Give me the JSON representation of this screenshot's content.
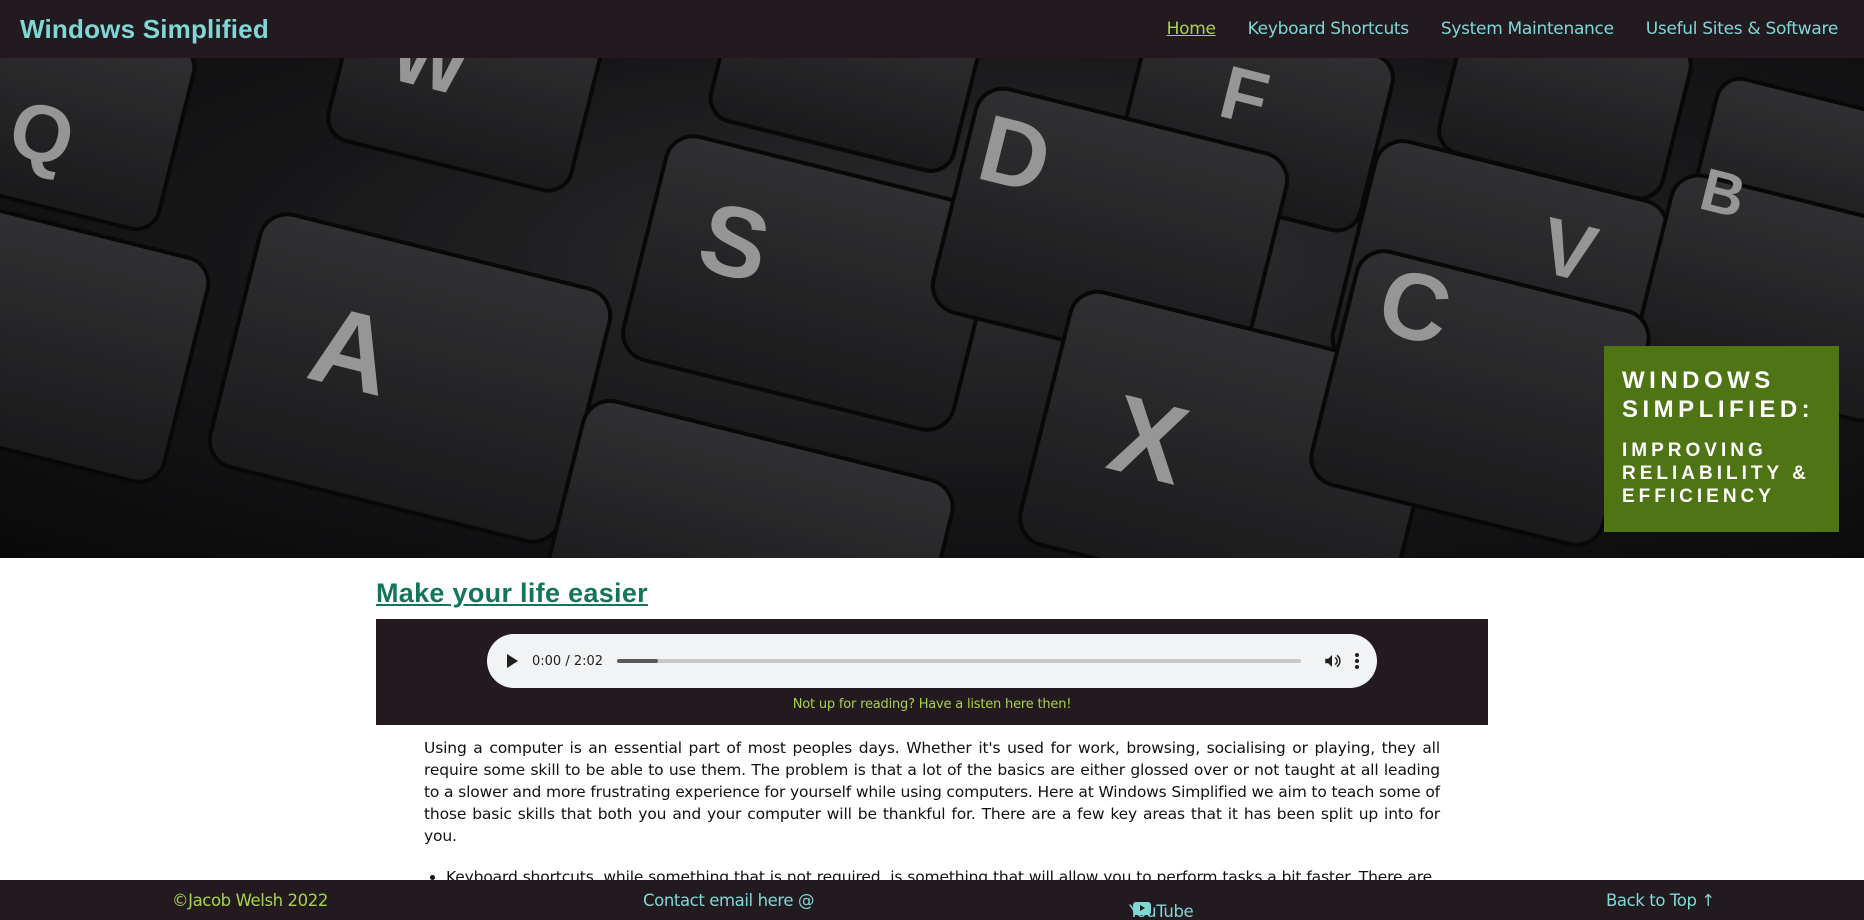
{
  "header": {
    "brand": "Windows Simplified",
    "nav": [
      {
        "label": "Home",
        "active": true
      },
      {
        "label": "Keyboard Shortcuts",
        "active": false
      },
      {
        "label": "System Maintenance",
        "active": false
      },
      {
        "label": "Useful Sites & Software",
        "active": false
      }
    ]
  },
  "hero": {
    "image": "keyboard-keys-photo",
    "badge_title": "WINDOWS SIMPLIFIED:",
    "badge_subtitle": "IMPROVING RELIABILITY & EFFICIENCY"
  },
  "main": {
    "title": "Make your life easier",
    "audio": {
      "time": "0:00 / 2:02",
      "progress": 0.06,
      "caption": "Not up for reading? Have a listen here then!"
    },
    "intro": "Using a computer is an essential part of most peoples days. Whether it's used for work, browsing, socialising or playing, they all require some skill to be able to use them. The problem is that a lot of the basics are either glossed over or not taught at all leading to a slower and more frustrating experience for yourself while using computers. Here at Windows Simplified we aim to teach some of those basic skills that both you and your computer will be thankful for. There are a few key areas that it has been split up into for you.",
    "bullets": [
      "Keyboard shortcuts, while something that is not required, is something that will allow you to perform tasks a bit faster. There are shortcuts for a wide variety of things. Head to the Keyboard Shortcuts page to find out more."
    ]
  },
  "footer": {
    "copyright": "©Jacob Welsh 2022",
    "contact": "Contact email here @",
    "youtube": "YouTube channel",
    "back_to_top": "Back to Top ↑"
  },
  "colors": {
    "nav_bg": "#221a1f",
    "accent_teal": "#7fd8d6",
    "accent_green": "#a8d34a",
    "badge_green": "#4e7414",
    "title_green": "#15755a"
  }
}
